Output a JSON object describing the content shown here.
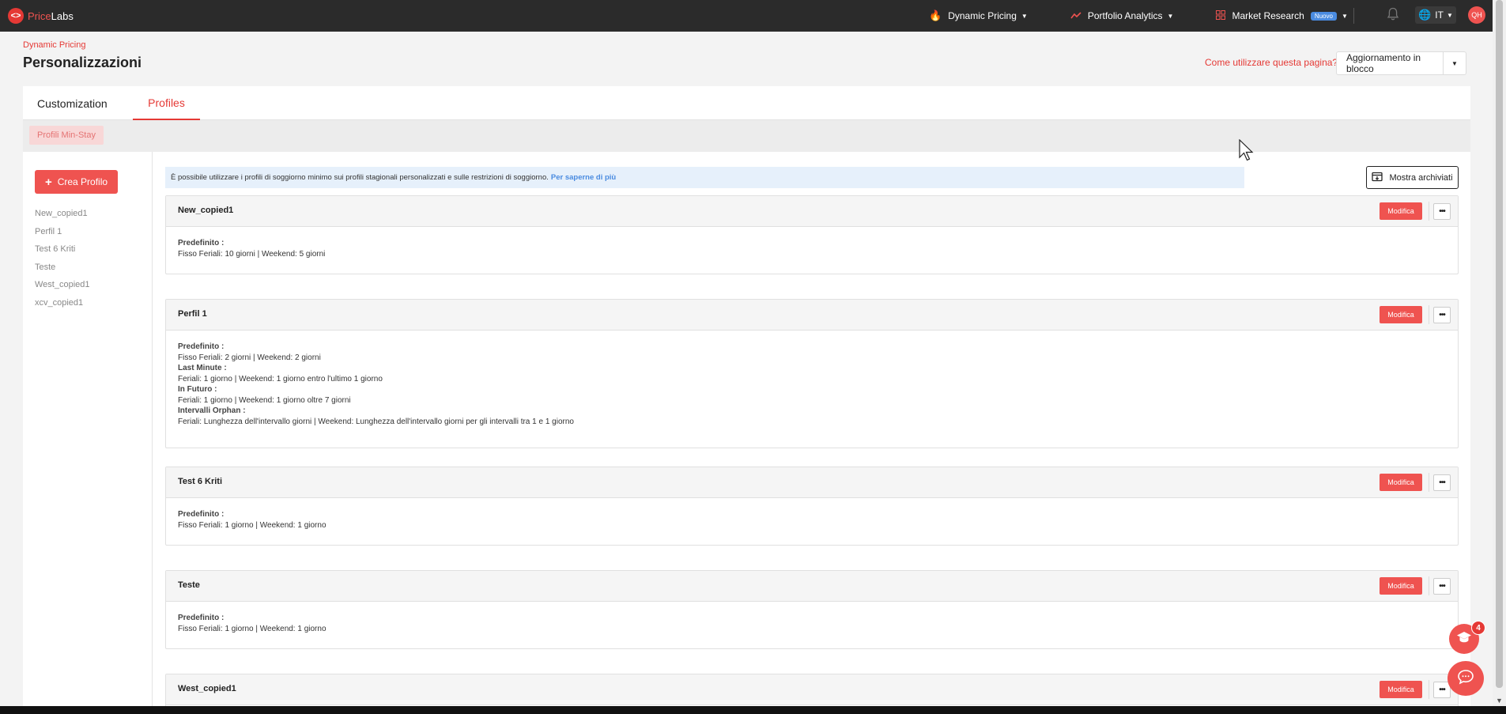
{
  "brand": {
    "logo_mark": "<>",
    "name_part1": "Price",
    "name_part2": "Labs"
  },
  "nav": {
    "items": [
      {
        "label": "Dynamic Pricing",
        "icon": "flame-icon"
      },
      {
        "label": "Portfolio Analytics",
        "icon": "trend-icon"
      },
      {
        "label": "Market Research",
        "icon": "grid-icon",
        "badge": "Nuovo"
      }
    ],
    "language": "IT",
    "avatar_initials": "QH"
  },
  "header": {
    "breadcrumb": "Dynamic Pricing",
    "title": "Personalizzazioni",
    "help_link": "Come utilizzare questa pagina?",
    "bulk_update": "Aggiornamento in blocco"
  },
  "tabs": [
    {
      "label": "Customization"
    },
    {
      "label": "Profiles"
    }
  ],
  "subtab": "Profili Min-Stay",
  "sidebar": {
    "create_button": "Crea Profilo",
    "profiles": [
      "New_copied1",
      "Perfil 1",
      "Test 6 Kriti",
      "Teste",
      "West_copied1",
      "xcv_copied1"
    ]
  },
  "main": {
    "info_text": "È possibile utilizzare i profili di soggiorno minimo sui profili stagionali personalizzati e sulle restrizioni di soggiorno.",
    "info_link": "Per saperne di più",
    "archive_button": "Mostra archiviati",
    "edit_label": "Modifica",
    "more_label": "•••",
    "cards": [
      {
        "name": "New_copied1",
        "lines": [
          {
            "label": "Predefinito :",
            "value": "Fisso Feriali: 10 giorni | Weekend: 5 giorni"
          }
        ]
      },
      {
        "name": "Perfil 1",
        "lines": [
          {
            "label": "Predefinito :",
            "value": "Fisso Feriali: 2 giorni | Weekend: 2 giorni"
          },
          {
            "label": "Last Minute :",
            "value": "Feriali: 1 giorno | Weekend: 1 giorno entro l'ultimo 1 giorno"
          },
          {
            "label": "In Futuro :",
            "value": "Feriali: 1 giorno | Weekend: 1 giorno oltre 7 giorni"
          },
          {
            "label": "Intervalli Orphan :",
            "value": "Feriali: Lunghezza dell'intervallo giorni | Weekend: Lunghezza dell'intervallo giorni per gli intervalli tra 1 e 1 giorno"
          }
        ]
      },
      {
        "name": "Test 6 Kriti",
        "lines": [
          {
            "label": "Predefinito :",
            "value": "Fisso Feriali: 1 giorno | Weekend: 1 giorno"
          }
        ]
      },
      {
        "name": "Teste",
        "lines": [
          {
            "label": "Predefinito :",
            "value": "Fisso Feriali: 1 giorno | Weekend: 1 giorno"
          }
        ]
      },
      {
        "name": "West_copied1",
        "lines": []
      }
    ]
  },
  "floating": {
    "help_count": "4"
  },
  "colors": {
    "accent": "#ef5350",
    "topbar": "#2b2b2b",
    "info_bg": "#e6f0fb",
    "link_blue": "#4a8be0"
  }
}
